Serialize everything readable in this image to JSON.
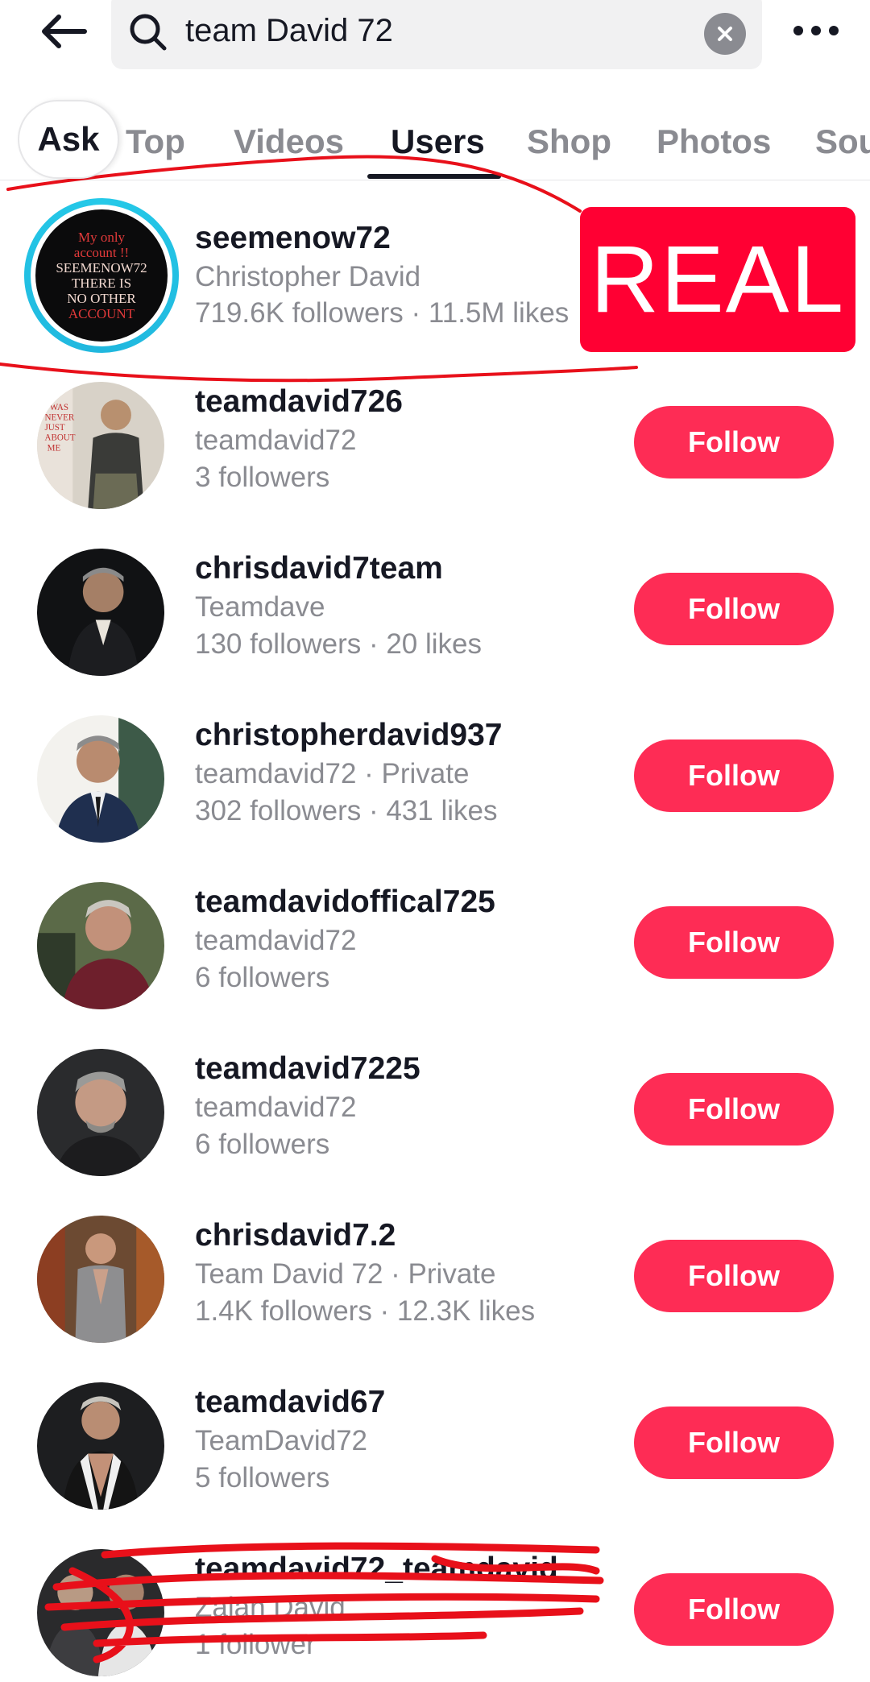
{
  "search": {
    "query": "team David 72"
  },
  "tabs": [
    {
      "label": "Ask"
    },
    {
      "label": "Top"
    },
    {
      "label": "Videos"
    },
    {
      "label": "Users"
    },
    {
      "label": "Shop"
    },
    {
      "label": "Photos"
    },
    {
      "label": "Sou"
    }
  ],
  "active_tab": "Users",
  "highlight": {
    "badge": "REAL",
    "avatar_text": [
      "My only",
      "account !!",
      "SEEMENOW72",
      "THERE IS",
      "NO OTHER",
      "ACCOUNT"
    ],
    "username": "seemenow72",
    "subtitle": "Christopher David",
    "stats": "719.6K followers · 11.5M likes"
  },
  "users": [
    {
      "username": "teamdavid726",
      "subtitle": "teamdavid72",
      "stats": "3 followers",
      "button": "Follow"
    },
    {
      "username": "chrisdavid7team",
      "subtitle": "Teamdave",
      "stats": "130 followers · 20 likes",
      "button": "Follow"
    },
    {
      "username": "christopherdavid937",
      "subtitle": "teamdavid72 · Private",
      "stats": "302 followers · 431 likes",
      "button": "Follow"
    },
    {
      "username": "teamdavidoffical725",
      "subtitle": "teamdavid72",
      "stats": "6 followers",
      "button": "Follow"
    },
    {
      "username": "teamdavid7225",
      "subtitle": "teamdavid72",
      "stats": "6 followers",
      "button": "Follow"
    },
    {
      "username": "chrisdavid7.2",
      "subtitle": "Team David 72 · Private",
      "stats": "1.4K followers · 12.3K likes",
      "button": "Follow"
    },
    {
      "username": "teamdavid67",
      "subtitle": "TeamDavid72",
      "stats": "5 followers",
      "button": "Follow"
    },
    {
      "username": "teamdavid72_teamdavid",
      "subtitle": "Zaian David",
      "stats": "1 follower",
      "button": "Follow"
    }
  ],
  "colors": {
    "follow": "#fe2c55",
    "badge": "#ff0033",
    "scribble": "#e8101a",
    "ring": "#25c9e8"
  }
}
